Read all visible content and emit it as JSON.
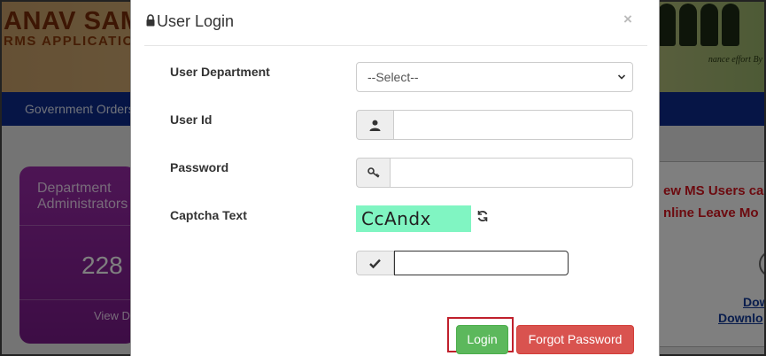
{
  "background": {
    "brand_text": "ANAV SAMPA",
    "brand_sub": "RMS APPLICATION",
    "tagline": "nance effort By",
    "nav_item": "Government Orders",
    "card": {
      "title": "Department Administrators",
      "count": "228",
      "view_label": "View D"
    },
    "notice": {
      "line1": "ew MS Users ca",
      "line2": "nline Leave Mo",
      "download1": "Dow",
      "download2": "Downlo"
    }
  },
  "modal": {
    "title": "User Login",
    "close_symbol": "×",
    "fields": {
      "department_label": "User Department",
      "department_selected": "--Select--",
      "userid_label": "User Id",
      "userid_value": "",
      "password_label": "Password",
      "password_value": "",
      "captcha_label": "Captcha Text",
      "captcha_text": "CcAndx",
      "captcha_input_value": ""
    },
    "buttons": {
      "login": "Login",
      "forgot": "Forgot Password"
    },
    "icons": {
      "title": "lock-icon",
      "userid": "user-icon",
      "password": "key-icon",
      "captcha_refresh": "refresh-icon",
      "captcha_confirm": "check-icon",
      "select_arrow": "chevron-down-icon"
    },
    "colors": {
      "login": "#5cb85c",
      "forgot": "#d9534f",
      "captcha_bg": "#80f5c2",
      "highlight": "#c0202c"
    }
  }
}
